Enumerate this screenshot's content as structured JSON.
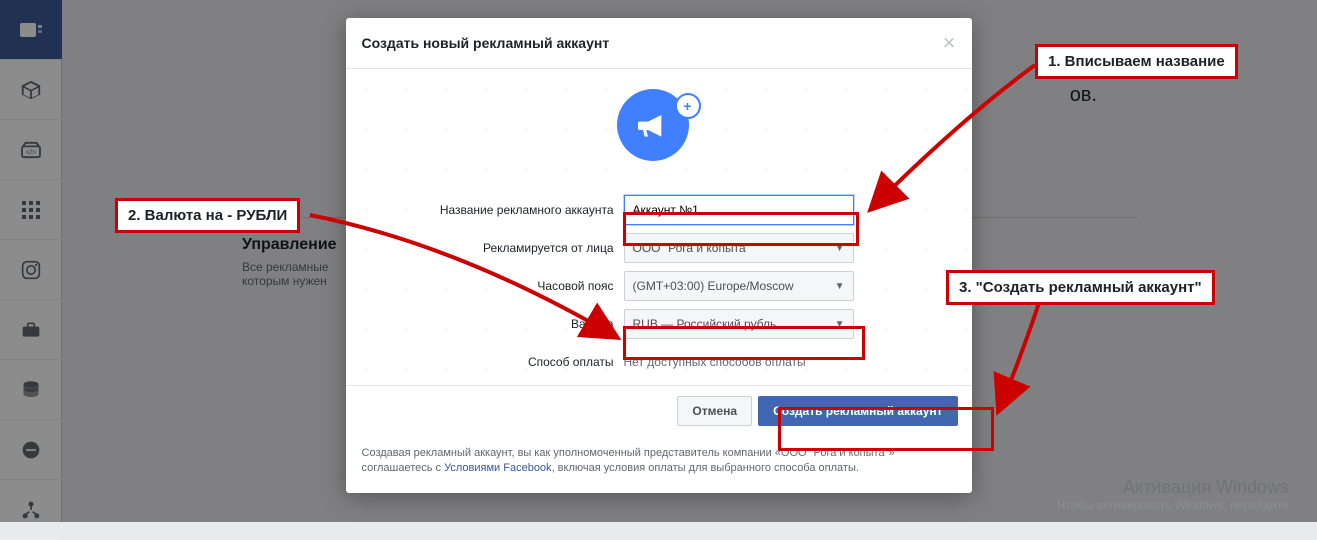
{
  "sidebar": {
    "items": [
      {
        "name": "ads-manager-icon"
      },
      {
        "name": "package-icon"
      },
      {
        "name": "pixel-icon"
      },
      {
        "name": "apps-grid-icon"
      },
      {
        "name": "instagram-icon"
      },
      {
        "name": "briefcase-icon"
      },
      {
        "name": "database-icon"
      },
      {
        "name": "minus-circle-icon"
      },
      {
        "name": "share-nodes-icon"
      }
    ]
  },
  "background": {
    "heading_suffix": "ов.",
    "section_title": "Управление",
    "section_desc_1": "Все рекламные",
    "section_desc_2": "которым нужен"
  },
  "modal": {
    "title": "Создать новый рекламный аккаунт",
    "labels": {
      "account_name": "Название рекламного аккаунта",
      "advertiser": "Рекламируется от лица",
      "timezone": "Часовой пояс",
      "currency": "Валюта",
      "payment": "Способ оплаты"
    },
    "values": {
      "account_name": "Аккаунт №1",
      "advertiser": "ООО \"Рога и копыта\"",
      "timezone": "(GMT+03:00) Europe/Moscow",
      "currency": "RUB — Российский рубль",
      "payment": "Нет доступных способов оплаты"
    },
    "buttons": {
      "cancel": "Отмена",
      "create": "Создать рекламный аккаунт"
    },
    "legal_pre": "Создавая рекламный аккаунт, вы как уполномоченный представитель компании «ООО \"Рога и копыта\"» соглашаетесь с ",
    "legal_link": "Условиями Facebook",
    "legal_post": ", включая условия оплаты для выбранного способа оплаты."
  },
  "annotations": {
    "a1": "1. Вписываем название",
    "a2": "2. Валюта на - РУБЛИ",
    "a3": "3. \"Создать рекламный аккаунт\""
  },
  "watermark": {
    "line1": "Активация Windows",
    "line2": "Чтобы активировать Windows, перейдите"
  }
}
